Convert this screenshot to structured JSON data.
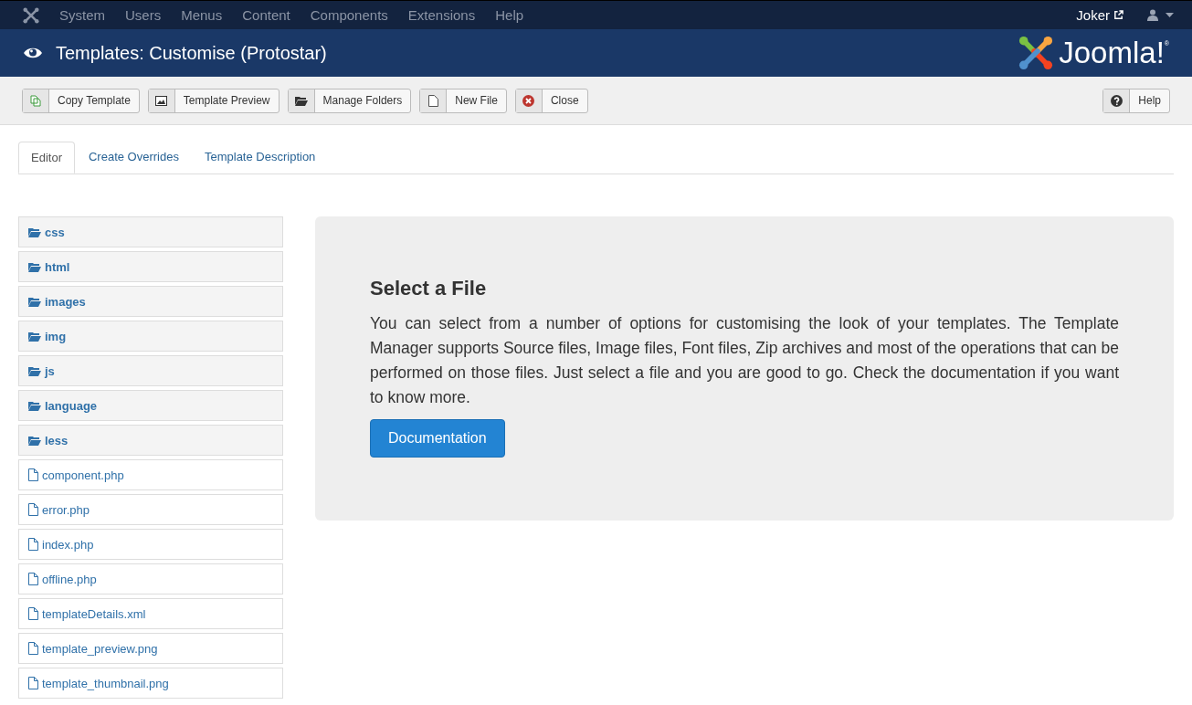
{
  "top_menu": [
    "System",
    "Users",
    "Menus",
    "Content",
    "Components",
    "Extensions",
    "Help"
  ],
  "user": {
    "name": "Joker"
  },
  "header": {
    "title": "Templates: Customise (Protostar)",
    "logo_text": "Joomla!",
    "logo_mark": "®"
  },
  "toolbar": [
    {
      "label": "Copy Template",
      "kind": "copy"
    },
    {
      "label": "Template Preview",
      "kind": "image"
    },
    {
      "label": "Manage Folders",
      "kind": "folder"
    },
    {
      "label": "New File",
      "kind": "file"
    },
    {
      "label": "Close",
      "kind": "close"
    }
  ],
  "help_button": {
    "label": "Help",
    "kind": "help"
  },
  "tabs": [
    {
      "label": "Editor",
      "selected": true
    },
    {
      "label": "Create Overrides",
      "selected": false
    },
    {
      "label": "Template Description",
      "selected": false
    }
  ],
  "files": [
    {
      "name": "css",
      "kind": "folder"
    },
    {
      "name": "html",
      "kind": "folder"
    },
    {
      "name": "images",
      "kind": "folder"
    },
    {
      "name": "img",
      "kind": "folder"
    },
    {
      "name": "js",
      "kind": "folder"
    },
    {
      "name": "language",
      "kind": "folder"
    },
    {
      "name": "less",
      "kind": "folder"
    },
    {
      "name": "component.php",
      "kind": "file"
    },
    {
      "name": "error.php",
      "kind": "file"
    },
    {
      "name": "index.php",
      "kind": "file"
    },
    {
      "name": "offline.php",
      "kind": "file"
    },
    {
      "name": "templateDetails.xml",
      "kind": "file"
    },
    {
      "name": "template_preview.png",
      "kind": "file"
    },
    {
      "name": "template_thumbnail.png",
      "kind": "file"
    }
  ],
  "panel": {
    "heading": "Select a File",
    "text": "You can select from a number of options for customising the look of your templates. The Template Manager supports Source files, Image files, Font files, Zip archives and most of the operations that can be performed on those files. Just select a file and you are good to go. Check the documentation if you want to know more.",
    "button": "Documentation"
  }
}
